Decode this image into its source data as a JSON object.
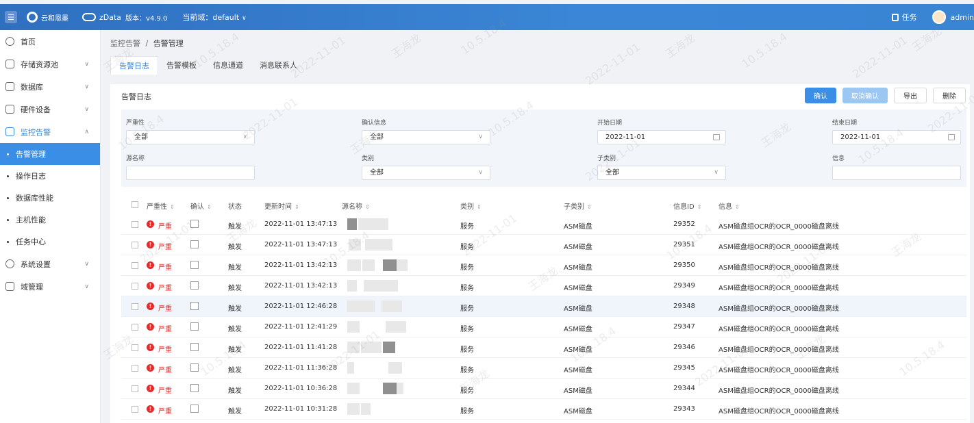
{
  "topbar": {
    "brand": "云和恩墨",
    "product": "zData",
    "version": "版本：v4.9.0",
    "domain": "当前域：default",
    "task": "任务",
    "user": "admin"
  },
  "sidebar": {
    "items": [
      {
        "label": "首页"
      },
      {
        "label": "存储资源池"
      },
      {
        "label": "数据库"
      },
      {
        "label": "硬件设备"
      },
      {
        "label": "监控告警"
      }
    ],
    "sub_items": [
      {
        "label": "告警管理"
      },
      {
        "label": "操作日志"
      },
      {
        "label": "数据库性能"
      },
      {
        "label": "主机性能"
      },
      {
        "label": "任务中心"
      }
    ],
    "bottom_items": [
      {
        "label": "系统设置"
      },
      {
        "label": "域管理"
      }
    ]
  },
  "breadcrumb": {
    "parent": "监控告警",
    "sep": "/",
    "current": "告警管理"
  },
  "tabs": [
    "告警日志",
    "告警模板",
    "信息通道",
    "消息联系人"
  ],
  "card": {
    "title": "告警日志",
    "buttons": {
      "confirm": "确认",
      "cancel_confirm": "取消确认",
      "export": "导出",
      "delete": "删除"
    }
  },
  "filters": {
    "severity": {
      "label": "严重性",
      "value": "全部"
    },
    "confirm_info": {
      "label": "确认信息",
      "value": "全部"
    },
    "start_date": {
      "label": "开始日期",
      "value": "2022-11-01"
    },
    "end_date": {
      "label": "结束日期",
      "value": "2022-11-01"
    },
    "source_name": {
      "label": "源名称",
      "value": ""
    },
    "category": {
      "label": "类别",
      "value": "全部"
    },
    "sub_category": {
      "label": "子类别",
      "value": "全部"
    },
    "info": {
      "label": "信息",
      "value": ""
    }
  },
  "table": {
    "columns": [
      "严重性",
      "确认",
      "状态",
      "更新时间",
      "源名称",
      "类别",
      "子类别",
      "信息ID",
      "信息"
    ],
    "rows": [
      {
        "severity": "严重",
        "status": "触发",
        "time": "2022-11-01 13:47:13",
        "category": "服务",
        "sub": "ASM磁盘",
        "id": "29352",
        "info": "ASM磁盘组OCR的OCR_0000磁盘离线"
      },
      {
        "severity": "严重",
        "status": "触发",
        "time": "2022-11-01 13:47:13",
        "category": "服务",
        "sub": "ASM磁盘",
        "id": "29351",
        "info": "ASM磁盘组OCR的OCR_0000磁盘离线"
      },
      {
        "severity": "严重",
        "status": "触发",
        "time": "2022-11-01 13:42:13",
        "category": "服务",
        "sub": "ASM磁盘",
        "id": "29350",
        "info": "ASM磁盘组OCR的OCR_0000磁盘离线"
      },
      {
        "severity": "严重",
        "status": "触发",
        "time": "2022-11-01 13:42:13",
        "category": "服务",
        "sub": "ASM磁盘",
        "id": "29349",
        "info": "ASM磁盘组OCR的OCR_0000磁盘离线"
      },
      {
        "severity": "严重",
        "status": "触发",
        "time": "2022-11-01 12:46:28",
        "category": "服务",
        "sub": "ASM磁盘",
        "id": "29348",
        "info": "ASM磁盘组OCR的OCR_0000磁盘离线"
      },
      {
        "severity": "严重",
        "status": "触发",
        "time": "2022-11-01 12:41:29",
        "category": "服务",
        "sub": "ASM磁盘",
        "id": "29347",
        "info": "ASM磁盘组OCR的OCR_0000磁盘离线"
      },
      {
        "severity": "严重",
        "status": "触发",
        "time": "2022-11-01 11:41:28",
        "category": "服务",
        "sub": "ASM磁盘",
        "id": "29346",
        "info": "ASM磁盘组OCR的OCR_0000磁盘离线"
      },
      {
        "severity": "严重",
        "status": "触发",
        "time": "2022-11-01 11:36:28",
        "category": "服务",
        "sub": "ASM磁盘",
        "id": "29345",
        "info": "ASM磁盘组OCR的OCR_0000磁盘离线"
      },
      {
        "severity": "严重",
        "status": "触发",
        "time": "2022-11-01 10:36:28",
        "category": "服务",
        "sub": "ASM磁盘",
        "id": "29344",
        "info": "ASM磁盘组OCR的OCR_0000磁盘离线"
      },
      {
        "severity": "严重",
        "status": "触发",
        "time": "2022-11-01 10:31:28",
        "category": "服务",
        "sub": "ASM磁盘",
        "id": "29343",
        "info": "ASM磁盘组OCR的OCR_0000磁盘离线"
      }
    ]
  },
  "watermark": [
    "王海龙",
    "10.5.18.4",
    "2022-11-01"
  ],
  "colors": {
    "accent": "#3a84d4",
    "danger": "#e32b2b",
    "topbar": "#3a84d4"
  }
}
